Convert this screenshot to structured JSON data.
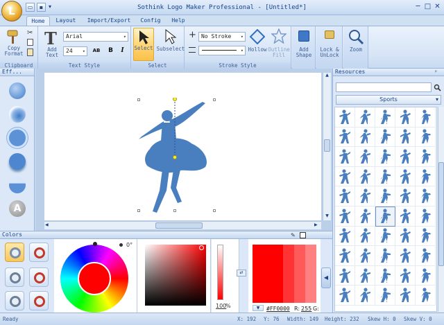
{
  "window": {
    "title": "Sothink Logo Maker Professional - [Untitled*]",
    "controls": {
      "minimize": "─",
      "maximize": "□",
      "close": "✕"
    }
  },
  "tabs": [
    {
      "label": "Home",
      "active": true
    },
    {
      "label": "Layout",
      "active": false
    },
    {
      "label": "Import/Export",
      "active": false
    },
    {
      "label": "Config",
      "active": false
    },
    {
      "label": "Help",
      "active": false
    }
  ],
  "ribbon": {
    "clipboard": {
      "label": "Clipboard",
      "copy_format": "Copy\nFormat"
    },
    "text_style": {
      "label": "Text Style",
      "add_text": "Add\nText",
      "font": "Arial",
      "size": "24",
      "bold": "B",
      "italic": "I",
      "char_spacing": "AB"
    },
    "select": {
      "label": "Select",
      "select": "Select",
      "subselect": "Subselect"
    },
    "stroke_style": {
      "label": "Stroke Style",
      "stroke": "No Stroke",
      "hollow": "Hollow",
      "outline_fill": "Outline\nFill"
    },
    "add_shape": "Add\nShape",
    "lock_unlock": "Lock &\nUnLock",
    "zoom": "Zoom"
  },
  "effects_panel": {
    "title": "Eff...",
    "items": [
      "sphere",
      "bevel",
      "emboss",
      "shadow",
      "gloss",
      "letter-a"
    ],
    "letter": "A"
  },
  "resources_panel": {
    "title": "Resources",
    "search_placeholder": "",
    "category": "Sports",
    "selected_index": 27
  },
  "colors_panel": {
    "title": "Colors",
    "hue_angle": "0°",
    "opacity": "100",
    "opacity_unit": "%",
    "hex": "#FF0000",
    "r_label": "R:",
    "r_value": "255",
    "g_label": "G:",
    "selected_color": "#FF0000",
    "swatches": [
      "#ff0000",
      "#ff3333",
      "#ff5a5a",
      "#ff8080"
    ]
  },
  "status": {
    "ready": "Ready",
    "x": "X: 192",
    "y": "Y: 76",
    "width": "Width: 149",
    "height": "Height: 232",
    "skew_h": "Skew H: 0",
    "skew_v": "Skew V: 0"
  },
  "colors": {
    "accent": "#15428b",
    "shape_fill": "#4a7fbf",
    "ribbon_bg": "#dce8f7"
  }
}
